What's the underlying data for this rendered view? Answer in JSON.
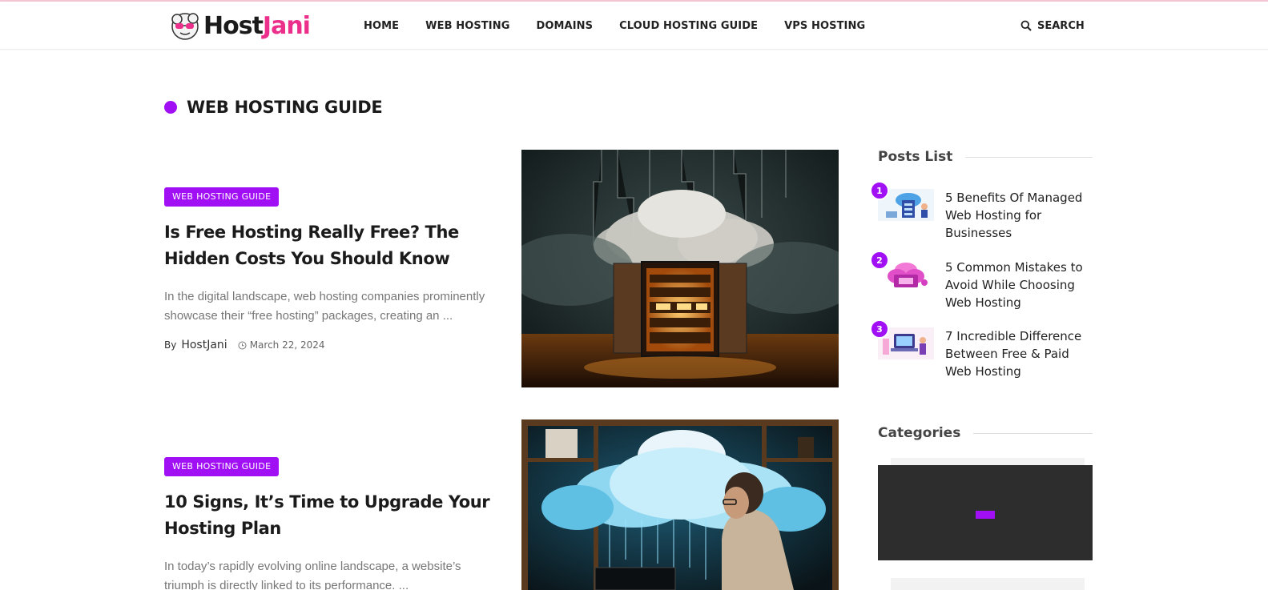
{
  "brand": {
    "logo_part1": "Host",
    "logo_part2": "Jani",
    "accent": "#a110f5",
    "logo_accent": "#ec2f8b"
  },
  "nav": {
    "items": [
      "HOME",
      "WEB HOSTING",
      "DOMAINS",
      "CLOUD HOSTING GUIDE",
      "VPS HOSTING"
    ],
    "search_label": "SEARCH",
    "search_icon": "search-icon"
  },
  "section": {
    "title": "WEB HOSTING GUIDE"
  },
  "posts": [
    {
      "category": "WEB HOSTING GUIDE",
      "title": "Is Free Hosting Really Free? The Hidden Costs You Should Know",
      "excerpt": "In the digital landscape, web hosting companies prominently showcase their “free hosting” packages, creating an ...",
      "by": "By",
      "author": "HostJani",
      "date": "March 22, 2024"
    },
    {
      "category": "WEB HOSTING GUIDE",
      "title": "10 Signs, It’s Time to Upgrade Your Hosting Plan",
      "excerpt": "In today’s rapidly evolving online landscape, a website’s triumph is directly linked to its performance. ..."
    }
  ],
  "sidebar": {
    "posts_list_heading": "Posts List",
    "posts_list": [
      {
        "num": "1",
        "title": "5 Benefits Of Managed Web Hosting for Businesses"
      },
      {
        "num": "2",
        "title": "5 Common Mistakes to Avoid While Choosing Web Hosting"
      },
      {
        "num": "3",
        "title": "7 Incredible Difference Between Free & Paid Web Hosting"
      }
    ],
    "categories_heading": "Categories"
  }
}
